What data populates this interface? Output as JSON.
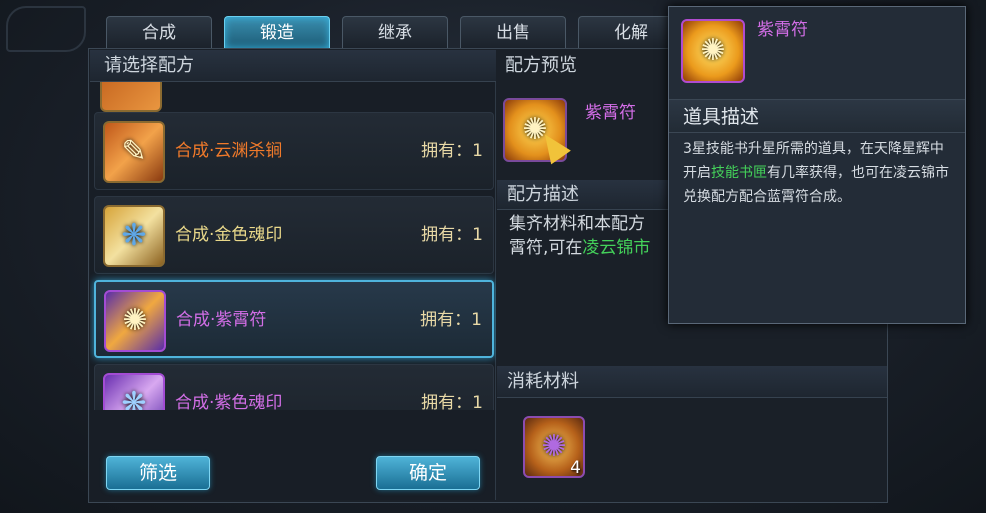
{
  "tabs": [
    "合成",
    "锻造",
    "继承",
    "出售",
    "化解"
  ],
  "left_panel": {
    "title": "请选择配方",
    "recipes": [
      {
        "name": "合成·云渊杀锏",
        "own": "拥有：1",
        "name_color": "#f07a2a"
      },
      {
        "name": "合成·金色魂印",
        "own": "拥有：1",
        "name_color": "#e9d88a"
      },
      {
        "name": "合成·紫霄符",
        "own": "拥有：1",
        "name_color": "#d26ee6"
      },
      {
        "name": "合成·紫色魂印",
        "own": "拥有：1",
        "name_color": "#d26ee6"
      }
    ],
    "filter_button": "筛选",
    "confirm_button": "确定"
  },
  "preview": {
    "title": "配方预览",
    "item_name": "紫霄符",
    "desc_title": "配方描述",
    "desc_line1": "集齐材料和本配方",
    "desc_line2_a": "霄符,可在",
    "desc_line2_b": "凌云锦市",
    "materials_title": "消耗材料",
    "material_count": "4"
  },
  "tooltip": {
    "item_name": "紫霄符",
    "section_title": "道具描述",
    "desc_a": "3星技能书升星所需的道具，在天降星辉中开启",
    "desc_green": "技能书匣",
    "desc_b": "有几率获得，也可在凌云锦市兑换配方配合蓝霄符合成。"
  },
  "colors": {
    "tab_active": "#3a8fb0",
    "accent_blue": "#4fb4dc",
    "purple_text": "#d26ee6",
    "orange_text": "#f07a2a",
    "green_text": "#44d25a",
    "gold_text": "#e8d9a6"
  },
  "icons": [
    "scroll-icon",
    "cursor-pointer-icon"
  ]
}
